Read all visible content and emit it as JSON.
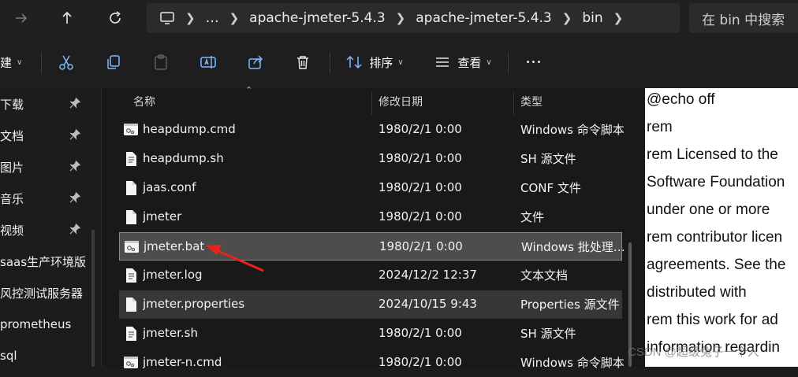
{
  "nav": {
    "breadcrumb": [
      "apache-jmeter-5.4.3",
      "apache-jmeter-5.4.3",
      "bin"
    ],
    "overflow_label": "…",
    "search_placeholder": "在 bin 中搜索"
  },
  "toolbar": {
    "new_label": "建",
    "sort_label": "排序",
    "view_label": "查看",
    "more_label": "•••"
  },
  "sidebar": {
    "items": [
      {
        "label": "下载",
        "pinned": true
      },
      {
        "label": "文档",
        "pinned": true
      },
      {
        "label": "图片",
        "pinned": true
      },
      {
        "label": "音乐",
        "pinned": true
      },
      {
        "label": "视频",
        "pinned": true
      },
      {
        "label": "saas生产环境版",
        "pinned": false
      },
      {
        "label": "风控测试服务器",
        "pinned": false
      },
      {
        "label": "prometheus",
        "pinned": false
      },
      {
        "label": "sql",
        "pinned": false
      }
    ]
  },
  "filelist": {
    "columns": {
      "name": "名称",
      "date": "修改日期",
      "type": "类型"
    },
    "rows": [
      {
        "name": "heapdump.cmd",
        "date": "1980/2/1 0:00",
        "type": "Windows 命令脚本",
        "icon": "script-file-icon",
        "state": ""
      },
      {
        "name": "heapdump.sh",
        "date": "1980/2/1 0:00",
        "type": "SH 源文件",
        "icon": "text-file-icon",
        "state": ""
      },
      {
        "name": "jaas.conf",
        "date": "1980/2/1 0:00",
        "type": "CONF 文件",
        "icon": "blank-file-icon",
        "state": ""
      },
      {
        "name": "jmeter",
        "date": "1980/2/1 0:00",
        "type": "文件",
        "icon": "blank-file-icon",
        "state": ""
      },
      {
        "name": "jmeter.bat",
        "date": "1980/2/1 0:00",
        "type": "Windows 批处理…",
        "icon": "script-file-icon",
        "state": "selected"
      },
      {
        "name": "jmeter.log",
        "date": "2024/12/2 12:37",
        "type": "文本文档",
        "icon": "text-file-icon",
        "state": ""
      },
      {
        "name": "jmeter.properties",
        "date": "2024/10/15 9:43",
        "type": "Properties 源文件",
        "icon": "blank-file-icon",
        "state": "hover"
      },
      {
        "name": "jmeter.sh",
        "date": "1980/2/1 0:00",
        "type": "SH 源文件",
        "icon": "text-file-icon",
        "state": ""
      },
      {
        "name": "jmeter-n.cmd",
        "date": "1980/2/1 0:00",
        "type": "Windows 命令脚本",
        "icon": "script-file-icon",
        "state": ""
      }
    ]
  },
  "preview": {
    "lines": [
      "@echo off",
      "rem",
      "rem Licensed to the",
      "Software Foundation",
      "under one or more",
      "rem contributor licen",
      "agreements.  See the",
      "distributed with",
      "rem this work for ad",
      "information regardin"
    ]
  },
  "watermark": "CSDN @超级兔子一个人",
  "colors": {
    "window_bg": "#1c1c1c",
    "selected_row": "#4d4d4d",
    "hover_row": "#373737",
    "annotation_arrow": "#e8231c",
    "preview_bg": "#ffffff"
  }
}
